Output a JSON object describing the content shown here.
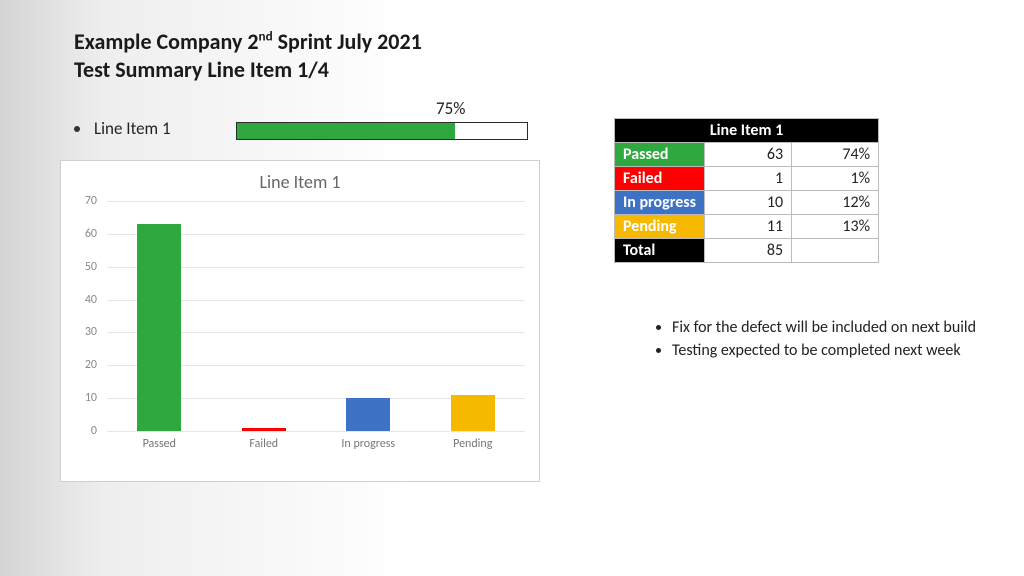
{
  "title_line1_pre": "Example Company  2",
  "title_line1_ord": "nd",
  "title_line1_post": " Sprint July 2021",
  "title_line2": "Test Summary Line Item 1/4",
  "line_item_label": "Line Item 1",
  "progress_percent_label": "75%",
  "progress_percent_value": 75,
  "chart_title": "Line Item 1",
  "table": {
    "header": "Line Item 1",
    "rows": [
      {
        "label": "Passed",
        "count": "63",
        "pct": "74%",
        "color": "#2fa83f"
      },
      {
        "label": "Failed",
        "count": "1",
        "pct": "1%",
        "color": "#ff0000"
      },
      {
        "label": "In progress",
        "count": "10",
        "pct": "12%",
        "color": "#3e72c4"
      },
      {
        "label": "Pending",
        "count": "11",
        "pct": "13%",
        "color": "#f6b900"
      }
    ],
    "total_label": "Total",
    "total_count": "85"
  },
  "notes": [
    "Fix for the defect will be included on next build",
    "Testing expected to be completed next week"
  ],
  "chart_data": {
    "type": "bar",
    "title": "Line Item 1",
    "categories": [
      "Passed",
      "Failed",
      "In progress",
      "Pending"
    ],
    "values": [
      63,
      1,
      10,
      11
    ],
    "colors": [
      "#2fa83f",
      "#ff0000",
      "#3e72c4",
      "#f6b900"
    ],
    "ylim": [
      0,
      70
    ],
    "yticks": [
      0,
      10,
      20,
      30,
      40,
      50,
      60,
      70
    ],
    "xlabel": "",
    "ylabel": ""
  }
}
